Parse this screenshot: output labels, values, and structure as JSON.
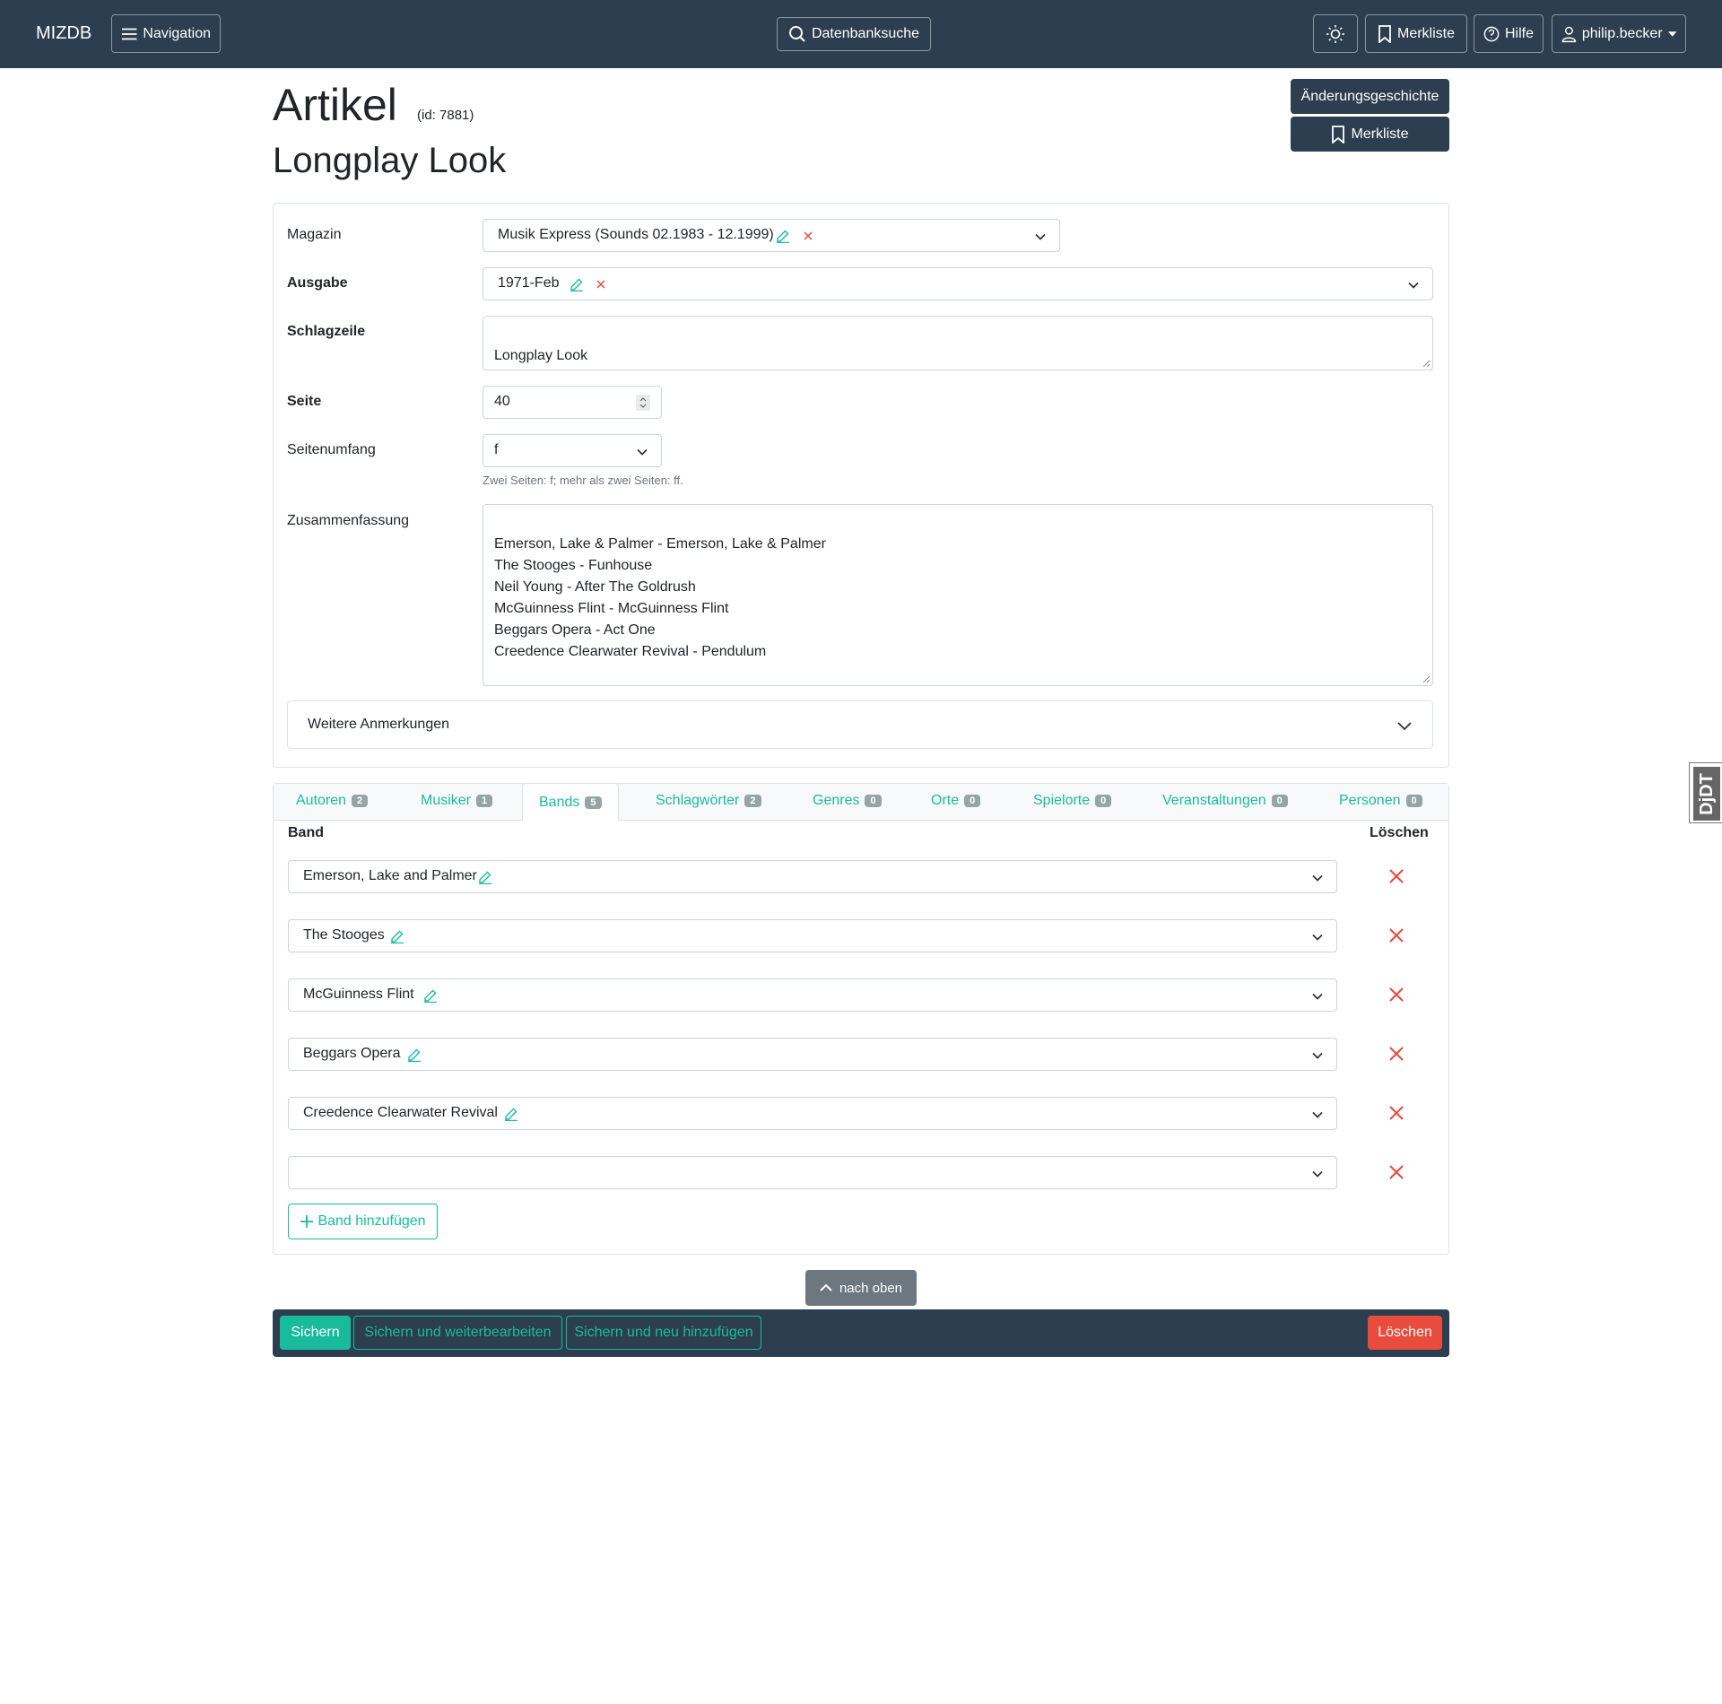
{
  "navbar": {
    "brand": "MIZDB",
    "navigation_label": "Navigation",
    "search_label": "Datenbanksuche",
    "watchlist_label": "Merkliste",
    "help_label": "Hilfe",
    "user_label": "philip.becker"
  },
  "header": {
    "title": "Artikel",
    "id_text": "(id: 7881)",
    "subtitle": "Longplay Look",
    "history_label": "Änderungsgeschichte",
    "watchlist_label": "Merkliste"
  },
  "form": {
    "magazin": {
      "label": "Magazin",
      "value": "Musik Express (Sounds 02.1983 - 12.1999)"
    },
    "ausgabe": {
      "label": "Ausgabe",
      "value": "1971-Feb"
    },
    "schlagzeile": {
      "label": "Schlagzeile",
      "value": "Longplay Look"
    },
    "seite": {
      "label": "Seite",
      "value": "40"
    },
    "seitenumfang": {
      "label": "Seitenumfang",
      "value": "f",
      "help": "Zwei Seiten: f; mehr als zwei Seiten: ff."
    },
    "zusammenfassung": {
      "label": "Zusammenfassung",
      "value": "Emerson, Lake & Palmer - Emerson, Lake & Palmer\nThe Stooges - Funhouse\nNeil Young - After The Goldrush\nMcGuinness Flint - McGuinness Flint\nBeggars Opera - Act One\nCreedence Clearwater Revival - Pendulum"
    },
    "accordion_label": "Weitere Anmerkungen"
  },
  "tabs": [
    {
      "label": "Autoren",
      "count": "2"
    },
    {
      "label": "Musiker",
      "count": "1"
    },
    {
      "label": "Bands",
      "count": "5"
    },
    {
      "label": "Schlagwörter",
      "count": "2"
    },
    {
      "label": "Genres",
      "count": "0"
    },
    {
      "label": "Orte",
      "count": "0"
    },
    {
      "label": "Spielorte",
      "count": "0"
    },
    {
      "label": "Veranstaltungen",
      "count": "0"
    },
    {
      "label": "Personen",
      "count": "0"
    }
  ],
  "bands": {
    "col_band": "Band",
    "col_delete": "Löschen",
    "rows": [
      "Emerson, Lake and Palmer",
      "The Stooges",
      "McGuinness Flint",
      "Beggars Opera",
      "Creedence Clearwater Revival",
      ""
    ],
    "add_label": "Band hinzufügen"
  },
  "back_to_top": "nach oben",
  "footer": {
    "save": "Sichern",
    "save_continue": "Sichern und weiterbearbeiten",
    "save_add": "Sichern und neu hinzufügen",
    "delete": "Löschen"
  },
  "debug_toolbar": "DjDT",
  "colors": {
    "navbar": "#2c3e50",
    "accent": "#18bc9c",
    "danger": "#e74c3c",
    "badge": "#95a5a6"
  }
}
